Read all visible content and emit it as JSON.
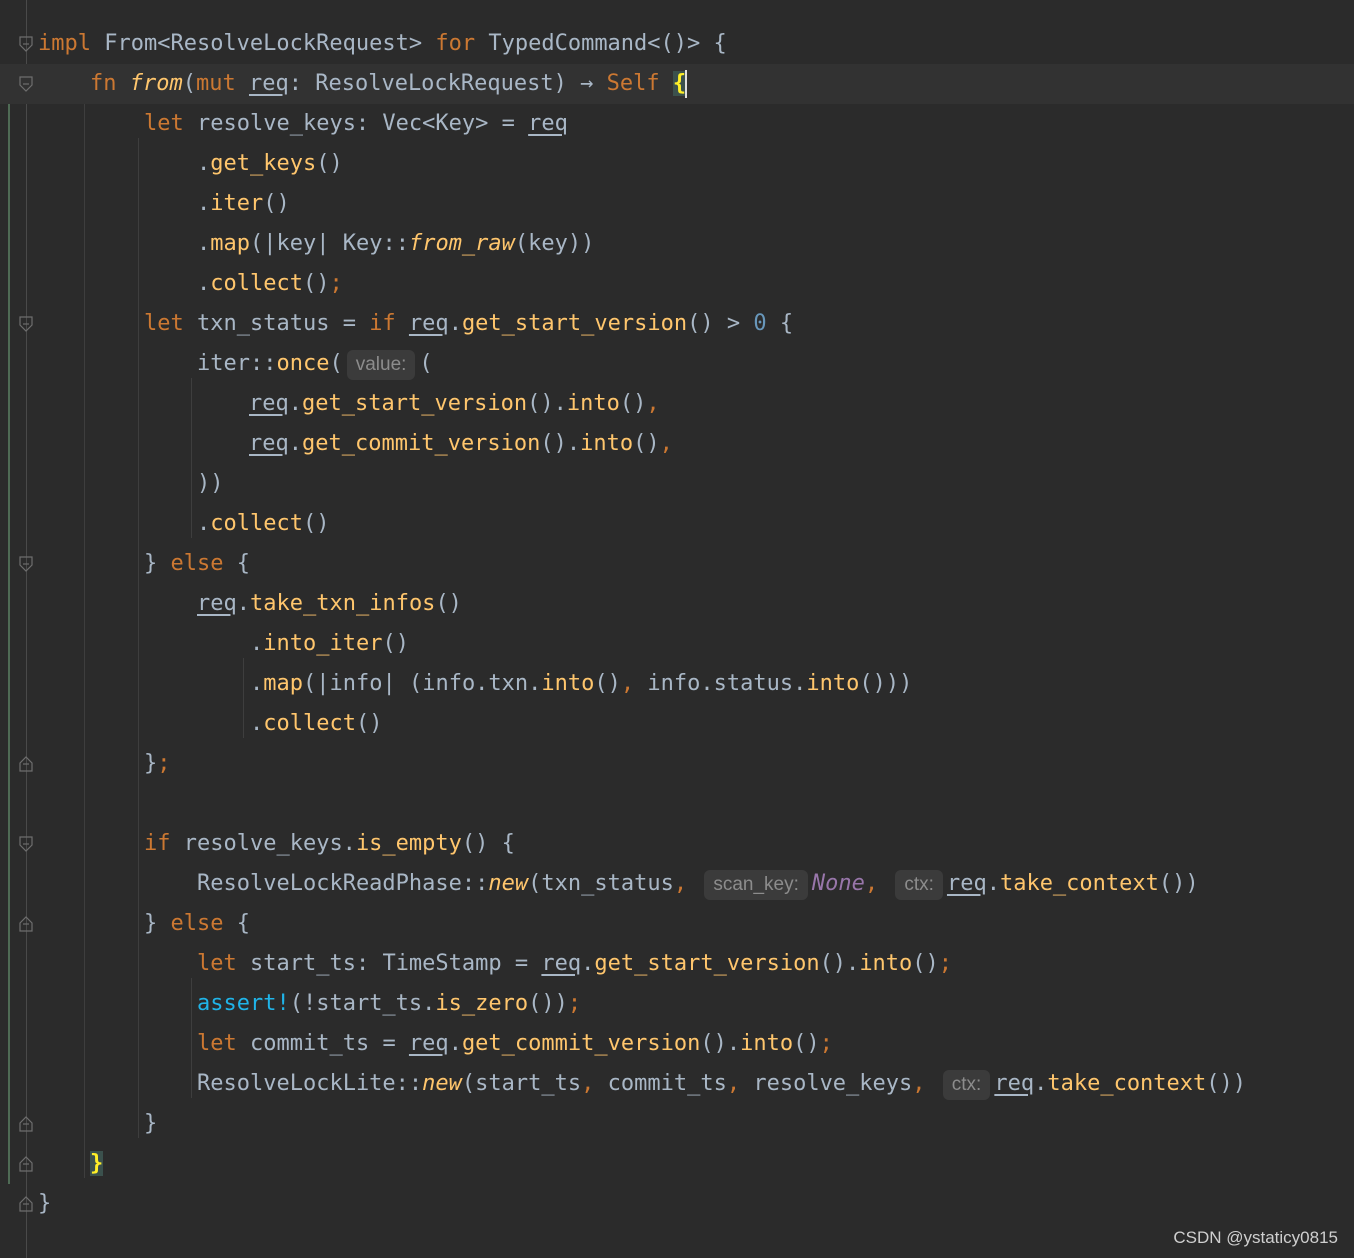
{
  "code_lines": [
    {
      "parts": [
        {
          "t": "impl",
          "c": "kw"
        },
        {
          "t": " From<ResolveLockRequest> "
        },
        {
          "t": "for",
          "c": "kw"
        },
        {
          "t": " TypedCommand<()> {"
        }
      ]
    },
    {
      "parts": [
        {
          "t": "fn",
          "c": "kw"
        },
        {
          "t": " "
        },
        {
          "t": "from",
          "c": "fnname"
        },
        {
          "t": "("
        },
        {
          "t": "mut",
          "c": "kw"
        },
        {
          "t": " "
        },
        {
          "t": "req",
          "c": "ul"
        },
        {
          "t": ": ResolveLockRequest) → "
        },
        {
          "t": "Self",
          "c": "kw"
        },
        {
          "t": " "
        },
        {
          "t": "{",
          "c": "brace-hl"
        }
      ]
    },
    {
      "parts": [
        {
          "t": "let",
          "c": "kw"
        },
        {
          "t": " resolve_keys: Vec<Key> = "
        },
        {
          "t": "req",
          "c": "ul"
        }
      ]
    },
    {
      "parts": [
        {
          "t": "."
        },
        {
          "t": "get_keys",
          "c": "meth"
        },
        {
          "t": "()"
        }
      ]
    },
    {
      "parts": [
        {
          "t": "."
        },
        {
          "t": "iter",
          "c": "meth"
        },
        {
          "t": "()"
        }
      ]
    },
    {
      "parts": [
        {
          "t": "."
        },
        {
          "t": "map",
          "c": "meth"
        },
        {
          "t": "(|key| Key::"
        },
        {
          "t": "from_raw",
          "c": "fnname"
        },
        {
          "t": "(key))"
        }
      ]
    },
    {
      "parts": [
        {
          "t": "."
        },
        {
          "t": "collect",
          "c": "meth"
        },
        {
          "t": "()"
        },
        {
          "t": ";",
          "c": "kw"
        }
      ]
    },
    {
      "parts": [
        {
          "t": "let",
          "c": "kw"
        },
        {
          "t": " txn_status = "
        },
        {
          "t": "if",
          "c": "kw"
        },
        {
          "t": " "
        },
        {
          "t": "req",
          "c": "ul"
        },
        {
          "t": "."
        },
        {
          "t": "get_start_version",
          "c": "meth"
        },
        {
          "t": "() > "
        },
        {
          "t": "0",
          "c": "num"
        },
        {
          "t": " {"
        }
      ]
    },
    {
      "parts": [
        {
          "t": "iter::"
        },
        {
          "t": "once",
          "c": "meth"
        },
        {
          "t": "("
        },
        {
          "t": "value:",
          "c": "hint"
        },
        {
          "t": "("
        }
      ]
    },
    {
      "parts": [
        {
          "t": "req",
          "c": "ul"
        },
        {
          "t": "."
        },
        {
          "t": "get_start_version",
          "c": "meth"
        },
        {
          "t": "()."
        },
        {
          "t": "into",
          "c": "meth"
        },
        {
          "t": "()"
        },
        {
          "t": ",",
          "c": "kw"
        }
      ]
    },
    {
      "parts": [
        {
          "t": "req",
          "c": "ul"
        },
        {
          "t": "."
        },
        {
          "t": "get_commit_version",
          "c": "meth"
        },
        {
          "t": "()."
        },
        {
          "t": "into",
          "c": "meth"
        },
        {
          "t": "()"
        },
        {
          "t": ",",
          "c": "kw"
        }
      ]
    },
    {
      "parts": [
        {
          "t": "))"
        }
      ]
    },
    {
      "parts": [
        {
          "t": "."
        },
        {
          "t": "collect",
          "c": "meth"
        },
        {
          "t": "()"
        }
      ]
    },
    {
      "parts": [
        {
          "t": "} "
        },
        {
          "t": "else",
          "c": "kw"
        },
        {
          "t": " {"
        }
      ]
    },
    {
      "parts": [
        {
          "t": "req",
          "c": "ul"
        },
        {
          "t": "."
        },
        {
          "t": "take_txn_infos",
          "c": "meth"
        },
        {
          "t": "()"
        }
      ]
    },
    {
      "parts": [
        {
          "t": "."
        },
        {
          "t": "into_iter",
          "c": "meth"
        },
        {
          "t": "()"
        }
      ]
    },
    {
      "parts": [
        {
          "t": "."
        },
        {
          "t": "map",
          "c": "meth"
        },
        {
          "t": "(|info| (info.txn."
        },
        {
          "t": "into",
          "c": "meth"
        },
        {
          "t": "()"
        },
        {
          "t": ",",
          "c": "kw"
        },
        {
          "t": " info.status."
        },
        {
          "t": "into",
          "c": "meth"
        },
        {
          "t": "()))"
        }
      ]
    },
    {
      "parts": [
        {
          "t": "."
        },
        {
          "t": "collect",
          "c": "meth"
        },
        {
          "t": "()"
        }
      ]
    },
    {
      "parts": [
        {
          "t": "}"
        },
        {
          "t": ";",
          "c": "kw"
        }
      ]
    },
    {
      "parts": []
    },
    {
      "parts": [
        {
          "t": "if",
          "c": "kw"
        },
        {
          "t": " resolve_keys."
        },
        {
          "t": "is_empty",
          "c": "meth"
        },
        {
          "t": "() {"
        }
      ]
    },
    {
      "parts": [
        {
          "t": "ResolveLockReadPhase::"
        },
        {
          "t": "new",
          "c": "fnname"
        },
        {
          "t": "(txn_status"
        },
        {
          "t": ",",
          "c": "kw"
        },
        {
          "t": " "
        },
        {
          "t": "scan_key:",
          "c": "hint"
        },
        {
          "t": "None",
          "c": "none"
        },
        {
          "t": ",",
          "c": "kw"
        },
        {
          "t": " "
        },
        {
          "t": "ctx:",
          "c": "hint"
        },
        {
          "t": "req",
          "c": "ul"
        },
        {
          "t": "."
        },
        {
          "t": "take_context",
          "c": "meth"
        },
        {
          "t": "())"
        }
      ]
    },
    {
      "parts": [
        {
          "t": "} "
        },
        {
          "t": "else",
          "c": "kw"
        },
        {
          "t": " {"
        }
      ]
    },
    {
      "parts": [
        {
          "t": "let",
          "c": "kw"
        },
        {
          "t": " start_ts: TimeStamp = "
        },
        {
          "t": "req",
          "c": "ul"
        },
        {
          "t": "."
        },
        {
          "t": "get_start_version",
          "c": "meth"
        },
        {
          "t": "()."
        },
        {
          "t": "into",
          "c": "meth"
        },
        {
          "t": "()"
        },
        {
          "t": ";",
          "c": "kw"
        }
      ]
    },
    {
      "parts": [
        {
          "t": "assert!",
          "c": "macro"
        },
        {
          "t": "(!start_ts."
        },
        {
          "t": "is_zero",
          "c": "meth"
        },
        {
          "t": "())"
        },
        {
          "t": ";",
          "c": "kw"
        }
      ]
    },
    {
      "parts": [
        {
          "t": "let",
          "c": "kw"
        },
        {
          "t": " commit_ts = "
        },
        {
          "t": "req",
          "c": "ul"
        },
        {
          "t": "."
        },
        {
          "t": "get_commit_version",
          "c": "meth"
        },
        {
          "t": "()."
        },
        {
          "t": "into",
          "c": "meth"
        },
        {
          "t": "()"
        },
        {
          "t": ";",
          "c": "kw"
        }
      ]
    },
    {
      "parts": [
        {
          "t": "ResolveLockLite::"
        },
        {
          "t": "new",
          "c": "fnname"
        },
        {
          "t": "(start_ts"
        },
        {
          "t": ",",
          "c": "kw"
        },
        {
          "t": " commit_ts"
        },
        {
          "t": ",",
          "c": "kw"
        },
        {
          "t": " resolve_keys"
        },
        {
          "t": ",",
          "c": "kw"
        },
        {
          "t": " "
        },
        {
          "t": "ctx:",
          "c": "hint"
        },
        {
          "t": "req",
          "c": "ul"
        },
        {
          "t": "."
        },
        {
          "t": "take_context",
          "c": "meth"
        },
        {
          "t": "())"
        }
      ]
    },
    {
      "parts": [
        {
          "t": "}"
        }
      ]
    },
    {
      "parts": [
        {
          "t": "}",
          "c": "brace-hl"
        }
      ]
    },
    {
      "parts": [
        {
          "t": "}"
        }
      ]
    }
  ],
  "watermark": "CSDN @ystaticy0815"
}
